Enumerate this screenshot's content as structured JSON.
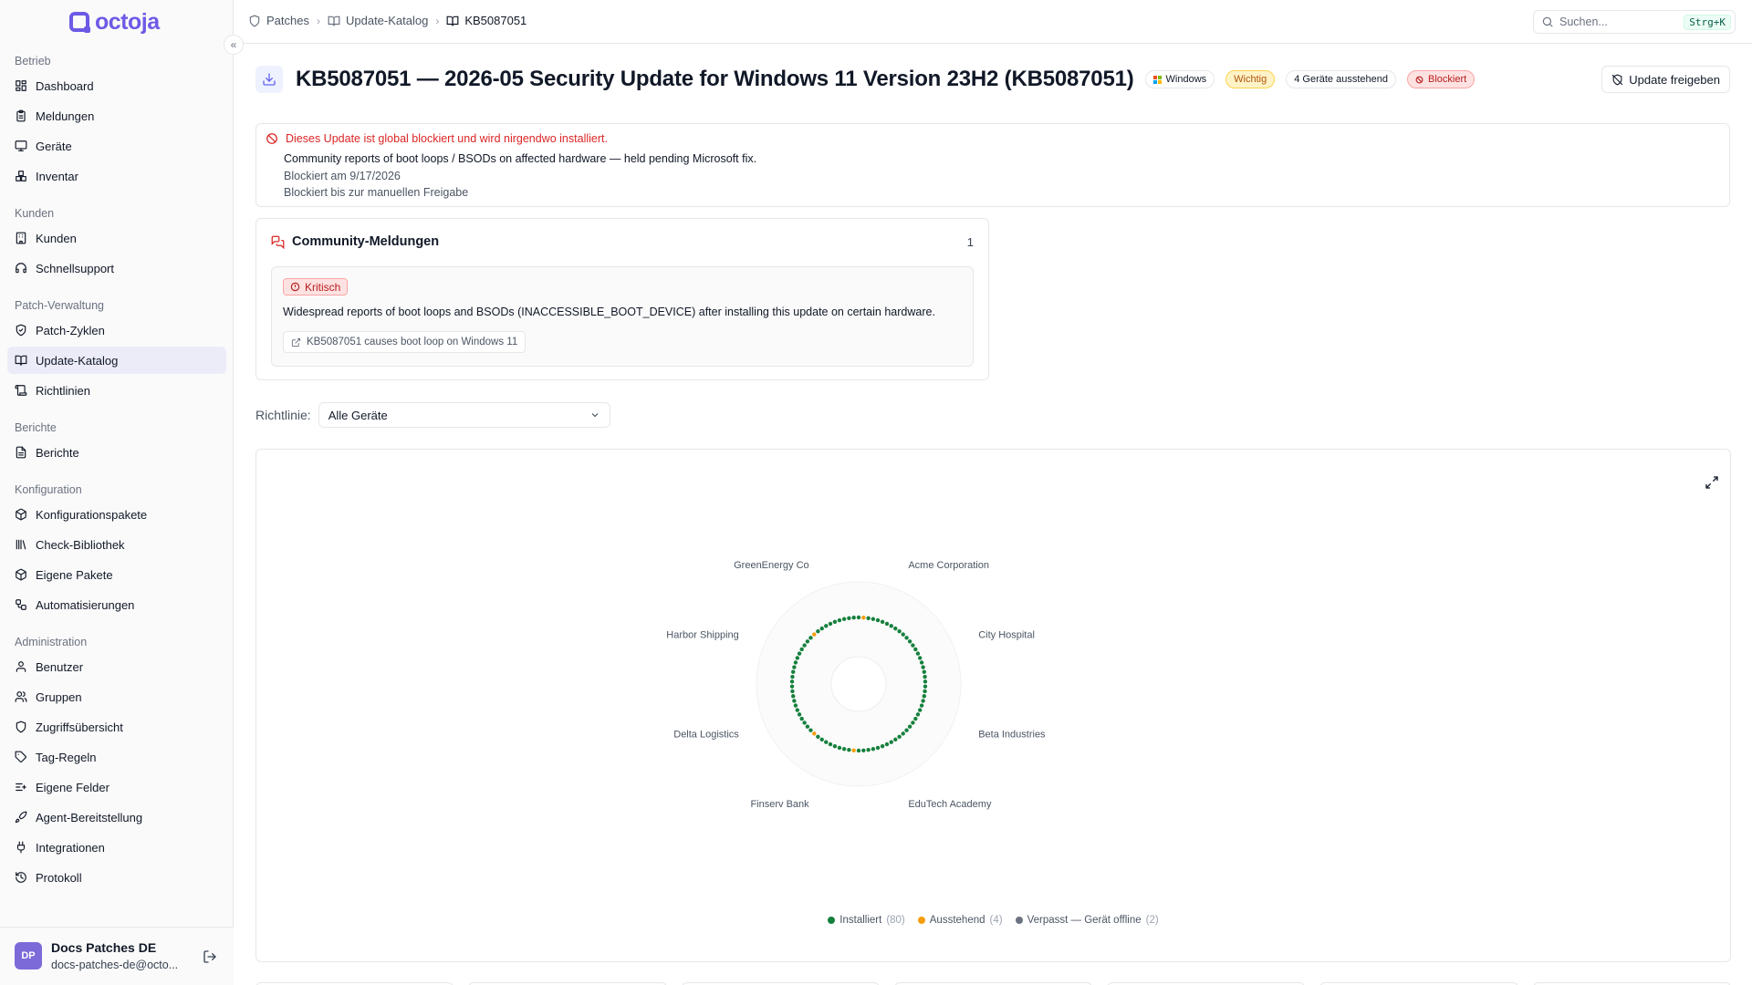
{
  "app": {
    "logo_text": "octoja",
    "brand_color": "#6d5ae6"
  },
  "sidebar": {
    "sections": [
      {
        "label": "Betrieb",
        "items": [
          {
            "label": "Dashboard",
            "icon": "dashboard-icon"
          },
          {
            "label": "Meldungen",
            "icon": "clipboard-icon"
          },
          {
            "label": "Geräte",
            "icon": "monitor-icon"
          },
          {
            "label": "Inventar",
            "icon": "boxes-icon"
          }
        ]
      },
      {
        "label": "Kunden",
        "items": [
          {
            "label": "Kunden",
            "icon": "building-icon"
          },
          {
            "label": "Schnellsupport",
            "icon": "headset-icon"
          }
        ]
      },
      {
        "label": "Patch-Verwaltung",
        "items": [
          {
            "label": "Patch-Zyklen",
            "icon": "shield-check-icon"
          },
          {
            "label": "Update-Katalog",
            "icon": "book-icon",
            "active": true
          },
          {
            "label": "Richtlinien",
            "icon": "scroll-icon"
          }
        ]
      },
      {
        "label": "Berichte",
        "items": [
          {
            "label": "Berichte",
            "icon": "report-icon"
          }
        ]
      },
      {
        "label": "Konfiguration",
        "items": [
          {
            "label": "Konfigurationspakete",
            "icon": "package-icon"
          },
          {
            "label": "Check-Bibliothek",
            "icon": "library-icon"
          },
          {
            "label": "Eigene Pakete",
            "icon": "package-icon"
          },
          {
            "label": "Automatisierungen",
            "icon": "workflow-icon"
          }
        ]
      },
      {
        "label": "Administration",
        "items": [
          {
            "label": "Benutzer",
            "icon": "user-icon"
          },
          {
            "label": "Gruppen",
            "icon": "users-icon"
          },
          {
            "label": "Zugriffsübersicht",
            "icon": "shield-icon"
          },
          {
            "label": "Tag-Regeln",
            "icon": "tag-icon"
          },
          {
            "label": "Eigene Felder",
            "icon": "fields-icon"
          },
          {
            "label": "Agent-Bereitstellung",
            "icon": "rocket-icon"
          },
          {
            "label": "Integrationen",
            "icon": "plug-icon"
          },
          {
            "label": "Protokoll",
            "icon": "history-icon"
          }
        ]
      }
    ],
    "user": {
      "initials": "DP",
      "name": "Docs Patches DE",
      "email": "docs-patches-de@octo..."
    }
  },
  "topbar": {
    "breadcrumbs": [
      "Patches",
      "Update-Katalog",
      "KB5087051"
    ],
    "search": {
      "placeholder": "Suchen...",
      "shortcut": "Strg+K"
    }
  },
  "update": {
    "title": "KB5087051 — 2026-05 Security Update for Windows 11 Version 23H2 (KB5087051)",
    "badges": {
      "os": "Windows",
      "priority": "Wichtig",
      "pending": "4 Geräte ausstehend",
      "blocked": "Blockiert"
    },
    "release_button": "Update freigeben"
  },
  "alert": {
    "title": "Dieses Update ist global blockiert und wird nirgendwo installiert.",
    "reason": "Community reports of boot loops / BSODs on affected hardware — held pending Microsoft fix.",
    "blocked_on": "Blockiert am 9/17/2026",
    "blocked_until": "Blockiert bis zur manuellen Freigabe"
  },
  "community": {
    "title": "Community-Meldungen",
    "count": "1",
    "reports": [
      {
        "severity": "Kritisch",
        "text": "Widespread reports of boot loops and BSODs (INACCESSIBLE_BOOT_DEVICE) after installing this update on certain hardware.",
        "link_label": "KB5087051 causes boot loop on Windows 11"
      }
    ]
  },
  "policy": {
    "label": "Richtlinie:",
    "selected": "Alle Geräte"
  },
  "chart_data": {
    "type": "radial-dot",
    "customers": [
      "Acme Corporation",
      "City Hospital",
      "Beta Industries",
      "EduTech Academy",
      "Finserv Bank",
      "Delta Logistics",
      "Harbor Shipping",
      "GreenEnergy Co"
    ],
    "series": [
      {
        "name": "Installiert",
        "count": 80,
        "color": "#15803d"
      },
      {
        "name": "Ausstehend",
        "count": 4,
        "color": "#f59e0b"
      },
      {
        "name": "Verpasst — Gerät offline",
        "count": 2,
        "color": "#6b7280"
      }
    ],
    "pending_positions": [
      1,
      44,
      53,
      76
    ],
    "missed_positions": []
  }
}
